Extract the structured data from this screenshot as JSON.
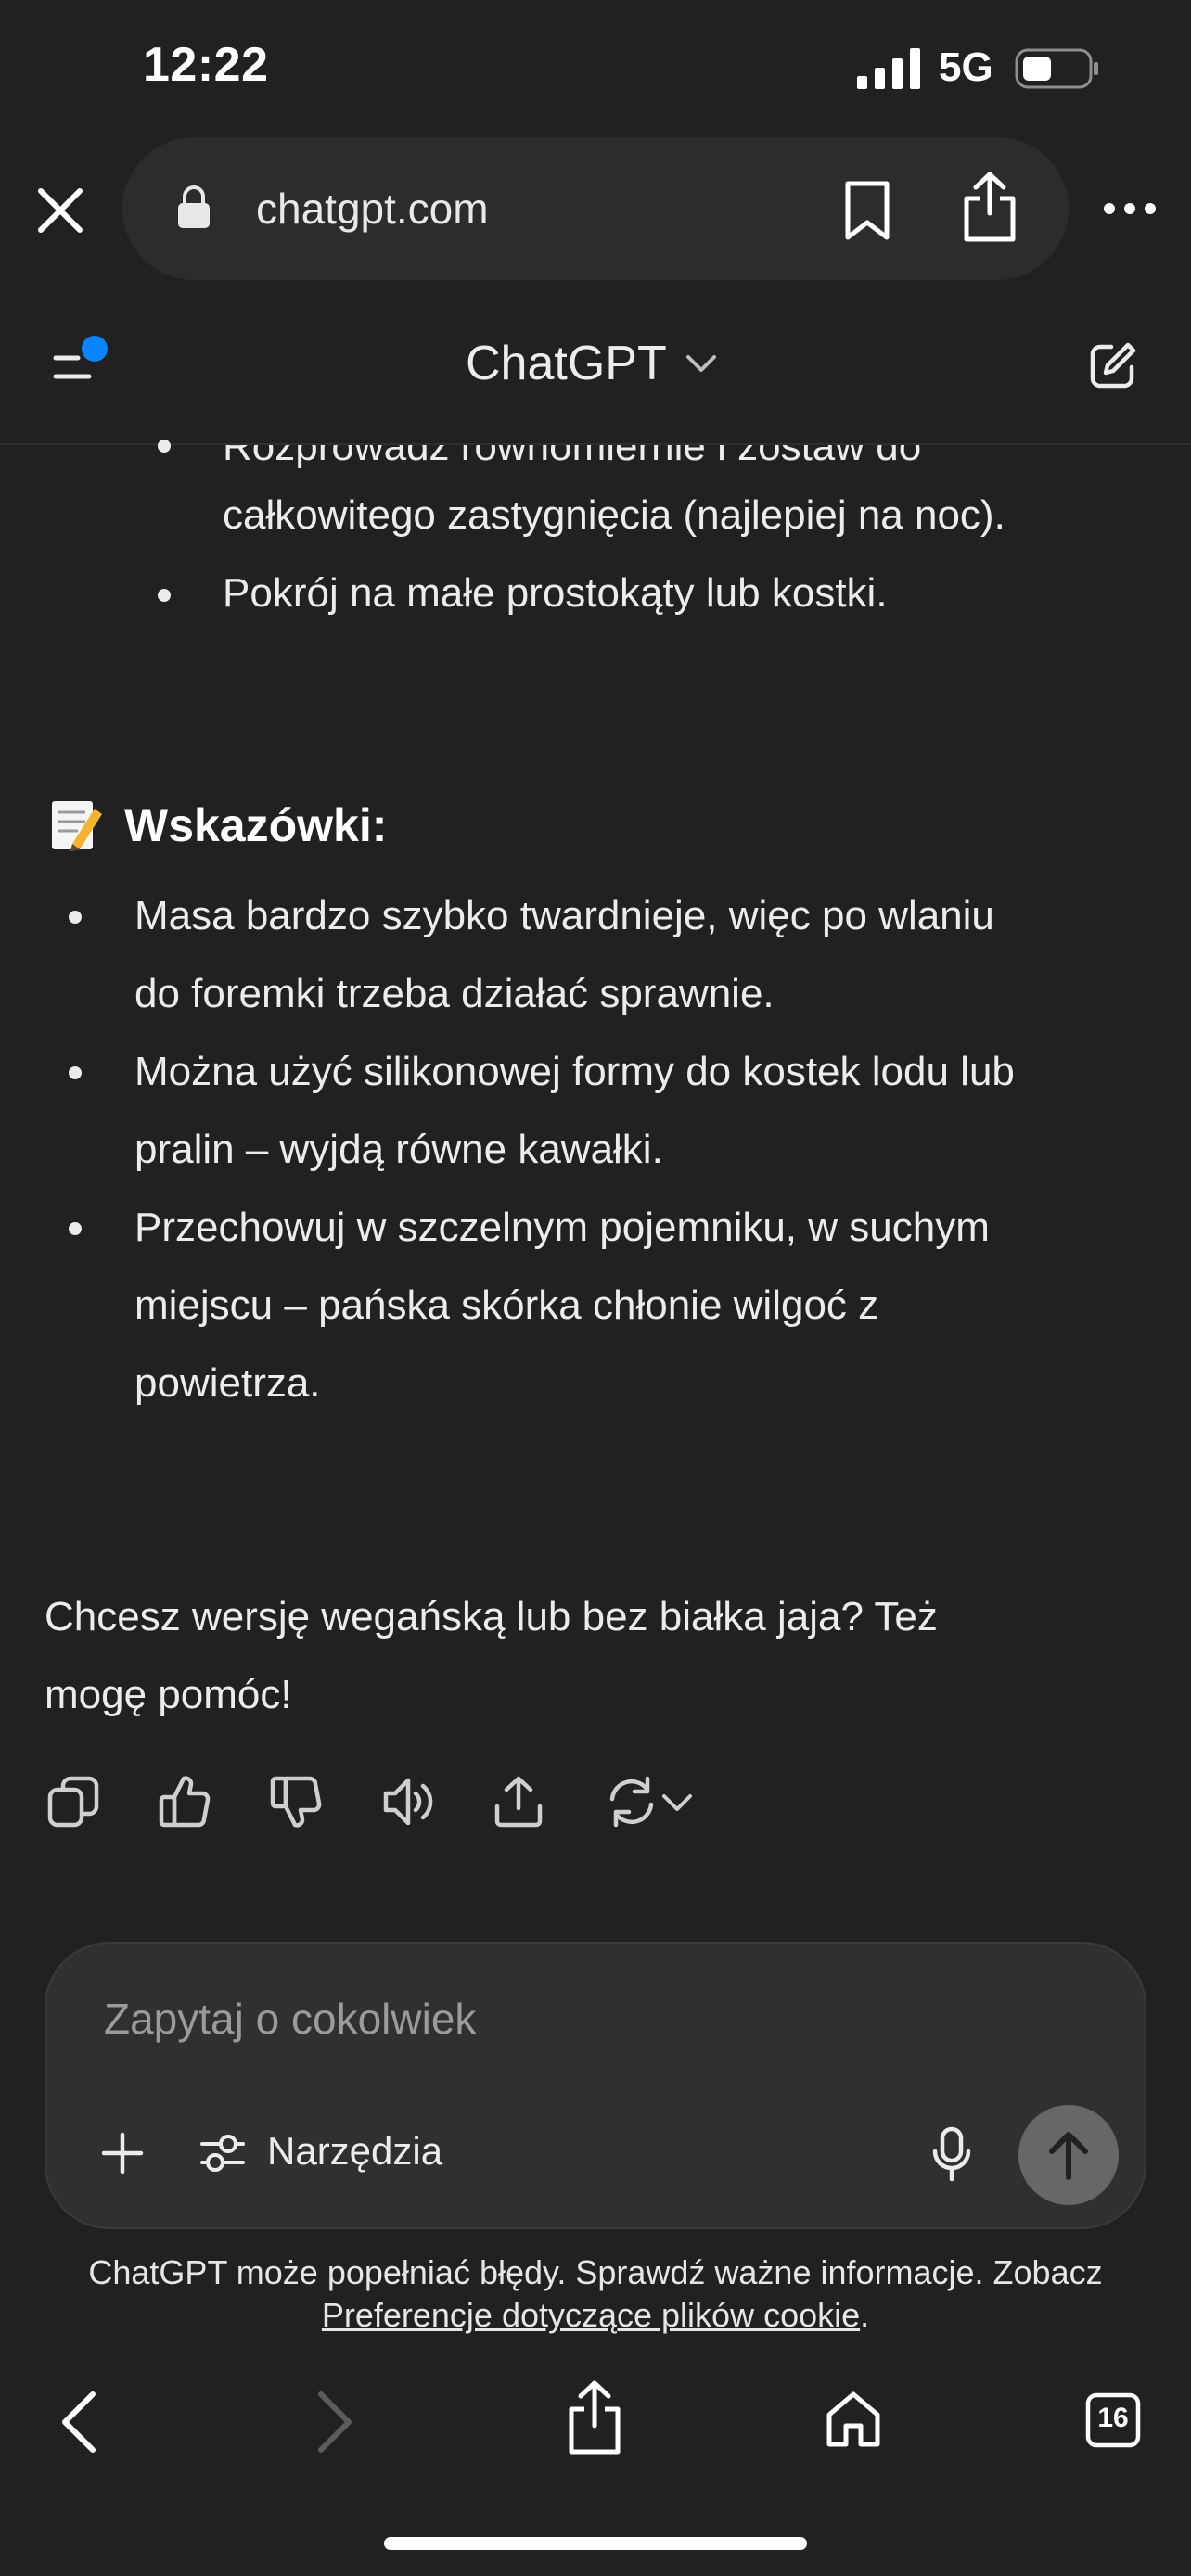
{
  "status_bar": {
    "time": "12:22",
    "network": "5G"
  },
  "browser": {
    "url": "chatgpt.com",
    "tab_count": "16"
  },
  "app": {
    "title": "ChatGPT"
  },
  "content": {
    "partial_line": "Rozprowadź równomiernie i zostaw do",
    "top_bullets": [
      [
        "całkowitego zastygnięcia (najlepiej na noc)."
      ],
      [
        "Pokrój na małe prostokąty lub kostki."
      ]
    ],
    "tips_heading": "Wskazówki:",
    "tips": [
      [
        "Masa bardzo szybko twardnieje, więc po wlaniu",
        "do foremki trzeba działać sprawnie."
      ],
      [
        "Można użyć silikonowej formy do kostek lodu lub",
        "pralin – wyjdą równe kawałki."
      ],
      [
        "Przechowuj w szczelnym pojemniku, w suchym",
        "miejscu – pańska skórka chłonie wilgoć z",
        "powietrza."
      ]
    ],
    "closing": [
      "Chcesz wersję wegańską lub bez białka jaja? Też",
      "mogę pomóc!"
    ]
  },
  "composer": {
    "placeholder": "Zapytaj o cokolwiek",
    "tools_label": "Narzędzia"
  },
  "disclaimer": {
    "text": "ChatGPT może popełniać błędy. Sprawdź ważne informacje. Zobacz",
    "link": "Preferencje dotyczące plików cookie",
    "suffix": "."
  },
  "icons": {
    "status": [
      "signal-icon",
      "battery-icon"
    ],
    "browser": [
      "close-icon",
      "lock-icon",
      "bookmark-icon",
      "share-icon",
      "more-icon"
    ],
    "header": [
      "menu-icon",
      "chevron-down-icon",
      "new-chat-icon"
    ],
    "actions": [
      "copy-icon",
      "thumbs-up-icon",
      "thumbs-down-icon",
      "read-aloud-icon",
      "share-icon",
      "regenerate-icon"
    ],
    "composer": [
      "plus-icon",
      "tools-icon",
      "mic-icon",
      "send-icon"
    ],
    "toolbar": [
      "back-icon",
      "forward-icon",
      "share-icon",
      "home-icon",
      "tabs-icon"
    ]
  },
  "colors": {
    "background": "#212121",
    "composer": "#303030",
    "accent_dot": "#0a84ff",
    "send_button": "#676767"
  }
}
